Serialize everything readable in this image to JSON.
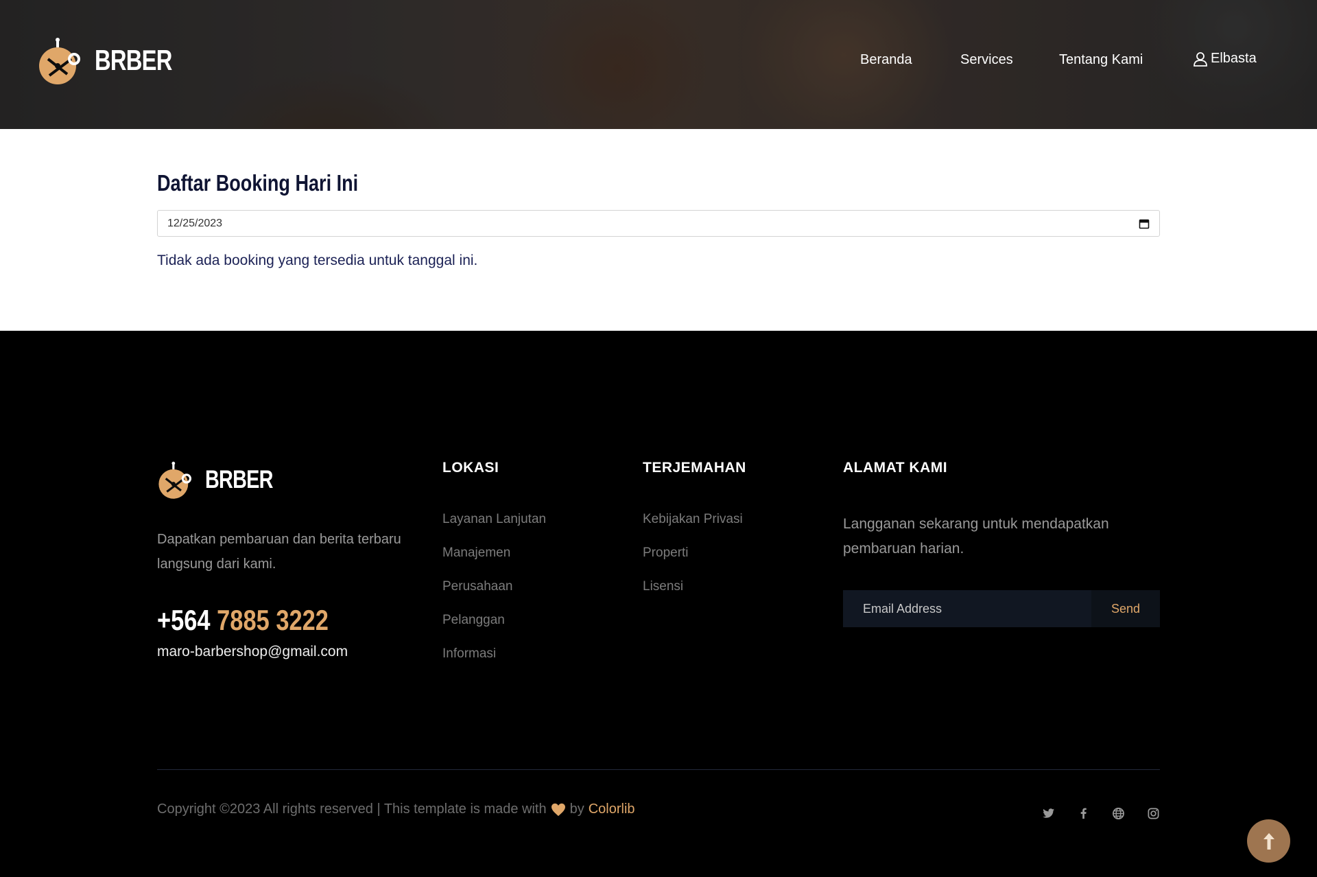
{
  "header": {
    "logo_text": "BRBER",
    "nav": [
      "Beranda",
      "Services",
      "Tentang Kami"
    ],
    "user_name": "Elbasta"
  },
  "main": {
    "title": "Daftar Booking Hari Ini",
    "date_value": "12/25/2023",
    "empty_message": "Tidak ada booking yang tersedia untuk tanggal ini."
  },
  "footer": {
    "logo_text": "BRBER",
    "description": "Dapatkan pembaruan dan berita terbaru langsung dari kami.",
    "phone_code": "+564",
    "phone_number": "7885 3222",
    "email": "maro-barbershop@gmail.com",
    "col1": {
      "title": "LOKASI",
      "links": [
        "Layanan Lanjutan",
        "Manajemen",
        "Perusahaan",
        "Pelanggan",
        "Informasi"
      ]
    },
    "col2": {
      "title": "TERJEMAHAN",
      "links": [
        "Kebijakan Privasi",
        "Properti",
        "Lisensi"
      ]
    },
    "col3": {
      "title": "ALAMAT KAMI",
      "text": "Langganan sekarang untuk mendapatkan pembaruan harian.",
      "email_placeholder": "Email Address",
      "send_label": "Send"
    },
    "copyright_prefix": "Copyright ©2023 All rights reserved | This template is made with",
    "copyright_by": "by",
    "copyright_brand": "Colorlib",
    "social_icons": [
      "twitter-icon",
      "facebook-icon",
      "globe-icon",
      "instagram-icon"
    ]
  },
  "colors": {
    "accent": "#e0a769",
    "title_navy": "#0f1433",
    "footer_bg": "#000000",
    "scroll_top_bg": "#9e7550"
  }
}
